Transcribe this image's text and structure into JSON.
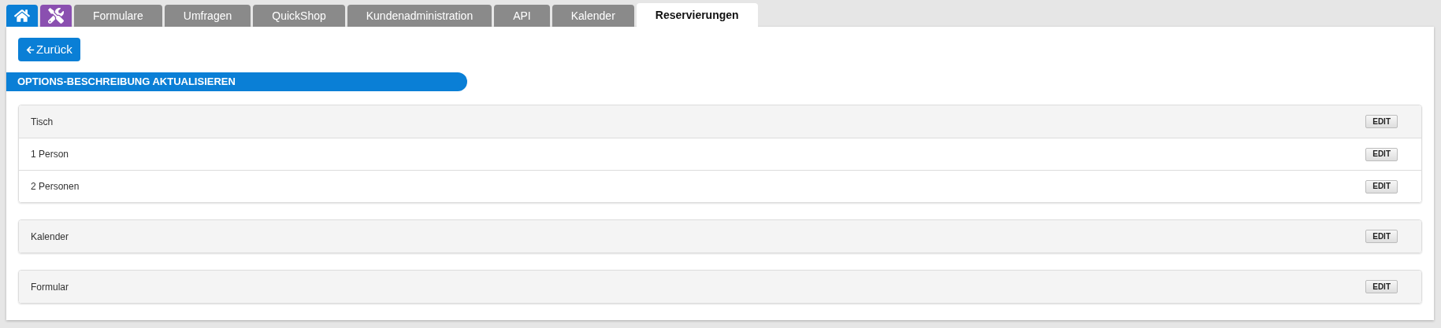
{
  "tabs": [
    {
      "kind": "home",
      "selected": false,
      "color": "#0a7fd6"
    },
    {
      "kind": "tools",
      "selected": false,
      "color": "#8a4fb0"
    },
    {
      "kind": "text",
      "label": "Formulare",
      "selected": false
    },
    {
      "kind": "text",
      "label": "Umfragen",
      "selected": false
    },
    {
      "kind": "text",
      "label": "QuickShop",
      "selected": false
    },
    {
      "kind": "text",
      "label": "Kundenadministration",
      "selected": false
    },
    {
      "kind": "text",
      "label": "API",
      "selected": false
    },
    {
      "kind": "text",
      "label": "Kalender",
      "selected": false
    },
    {
      "kind": "text",
      "label": "Reservierungen",
      "selected": true
    }
  ],
  "back_button": {
    "label": "Zurück"
  },
  "section_title": "OPTIONS-BESCHREIBUNG AKTUALISIEREN",
  "groups": [
    {
      "rows": [
        {
          "kind": "header",
          "label": "Tisch",
          "button": "EDIT"
        },
        {
          "kind": "option",
          "label": "1 Person",
          "button": "EDIT"
        },
        {
          "kind": "option",
          "label": "2 Personen",
          "button": "EDIT"
        }
      ]
    },
    {
      "rows": [
        {
          "kind": "header",
          "label": "Kalender",
          "button": "EDIT"
        }
      ]
    },
    {
      "rows": [
        {
          "kind": "header",
          "label": "Formular",
          "button": "EDIT"
        }
      ]
    }
  ]
}
